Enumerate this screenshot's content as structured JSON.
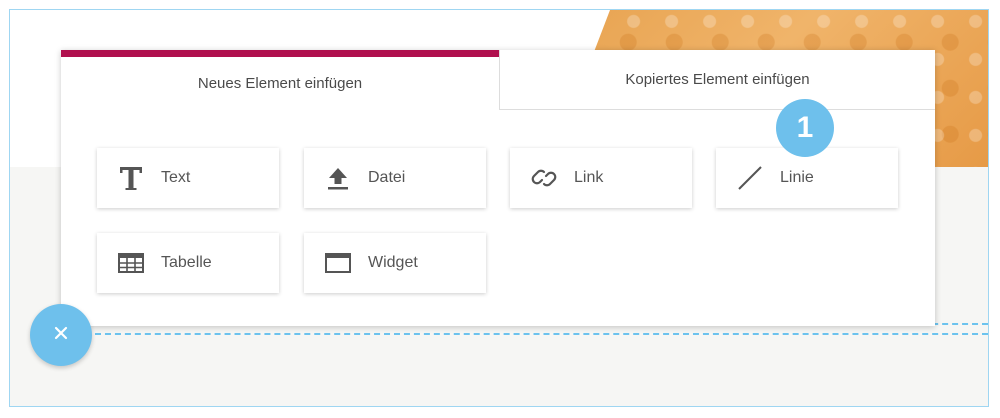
{
  "tabs": [
    {
      "label": "Neues Element einfügen",
      "active": true
    },
    {
      "label": "Kopiertes Element einfügen",
      "active": false
    }
  ],
  "elements": [
    {
      "label": "Text",
      "icon": "text-icon"
    },
    {
      "label": "Datei",
      "icon": "upload-icon"
    },
    {
      "label": "Link",
      "icon": "link-icon"
    },
    {
      "label": "Linie",
      "icon": "line-icon"
    },
    {
      "label": "Tabelle",
      "icon": "table-icon"
    },
    {
      "label": "Widget",
      "icon": "widget-icon"
    }
  ],
  "badge": {
    "number": "1"
  },
  "colors": {
    "accent": "#b0104e",
    "fab": "#6ec0ec",
    "frame": "#9fd6f2",
    "deco": "#e7a24f"
  }
}
